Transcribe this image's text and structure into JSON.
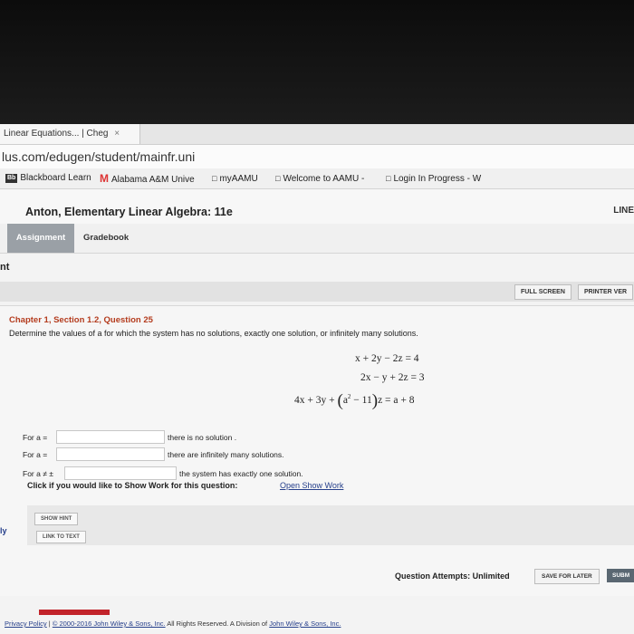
{
  "browser": {
    "tab_title": "Linear Equations... | Cheg",
    "tab_close": "×",
    "url": "lus.com/edugen/student/mainfr.uni",
    "bookmarks": [
      {
        "icon": "Bb",
        "label": "Blackboard Learn"
      },
      {
        "icon": "M",
        "label": "Alabama A&M Unive"
      },
      {
        "icon": "doc-icon",
        "label": "myAAMU"
      },
      {
        "icon": "doc-icon",
        "label": "Welcome to AAMU -"
      },
      {
        "icon": "doc-icon",
        "label": "Login In Progress - W"
      }
    ]
  },
  "header": {
    "course_title": "Anton, Elementary Linear Algebra: 11e",
    "top_right": "LINE"
  },
  "nav_tabs": {
    "assignment": "Assignment",
    "gradebook": "Gradebook"
  },
  "breadcrumb": "nt",
  "toolbar": {
    "full_screen": "FULL SCREEN",
    "printer_version": "PRINTER VER"
  },
  "question": {
    "title": "Chapter 1, Section 1.2, Question 25",
    "prompt": "Determine the values of a for which the system has no solutions, exactly one solution, or infinitely many solutions.",
    "equations": {
      "eq1": "x + 2y − 2z = 4",
      "eq2": "2x − y + 2z = 3",
      "eq3_lhs": "4x + 3y + ",
      "eq3_a2": "a",
      "eq3_exp": "2",
      "eq3_rest": " − 11",
      "eq3_rhs": "z = a + 8"
    },
    "answers": [
      {
        "label": "For a =",
        "value": "",
        "description": "there is no solution ."
      },
      {
        "label": "For a =",
        "value": "",
        "description": "there are infinitely many solutions."
      },
      {
        "label": "For a ≠ ±",
        "value": "",
        "description": "the system has exactly one solution."
      }
    ],
    "show_work_prompt": "Click if you would like to Show Work for this question:",
    "show_work_link": "Open Show Work",
    "show_hint": "SHOW HINT",
    "link_to_text": "LINK TO TEXT",
    "left_marker": "ly",
    "attempts": "Question Attempts: Unlimited",
    "save_later": "SAVE FOR LATER",
    "submit": "SUBM"
  },
  "footer": {
    "privacy": "Privacy Policy",
    "sep": "|",
    "copyright_link": "© 2000-2016 John Wiley & Sons, Inc.",
    "rights": " All Rights Reserved. A Division of ",
    "company_link": "John Wiley & Sons, Inc."
  }
}
